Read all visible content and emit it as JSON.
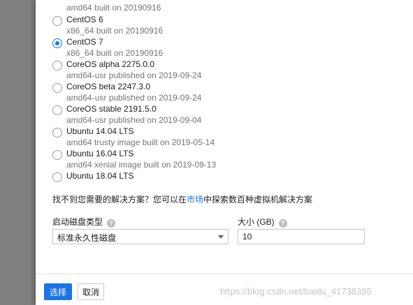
{
  "os_list": [
    {
      "name": "",
      "desc": "amd64 built on 20190916",
      "checked": false
    },
    {
      "name": "CentOS 6",
      "desc": "x86_64 built on 20190916",
      "checked": false
    },
    {
      "name": "CentOS 7",
      "desc": "x86_64 built on 20190916",
      "checked": true
    },
    {
      "name": "CoreOS alpha 2275.0.0",
      "desc": "amd64-usr published on 2019-09-24",
      "checked": false
    },
    {
      "name": "CoreOS beta 2247.3.0",
      "desc": "amd64-usr published on 2019-09-24",
      "checked": false
    },
    {
      "name": "CoreOS stable 2191.5.0",
      "desc": "amd64-usr published on 2019-09-04",
      "checked": false
    },
    {
      "name": "Ubuntu 14.04 LTS",
      "desc": "amd64 trusty image built on 2019-05-14",
      "checked": false
    },
    {
      "name": "Ubuntu 16.04 LTS",
      "desc": "amd64 xenial image built on 2019-09-13",
      "checked": false
    },
    {
      "name": "Ubuntu 18.04 LTS",
      "desc": "",
      "checked": false
    }
  ],
  "hint": {
    "prefix": "找不到您需要的解决方案？您可以在",
    "link": "市场",
    "suffix": "中探索数百种虚拟机解决方案"
  },
  "disk_type": {
    "label": "启动磁盘类型",
    "value": "标准永久性磁盘"
  },
  "disk_size": {
    "label": "大小 (GB)",
    "value": "10"
  },
  "buttons": {
    "select": "选择",
    "cancel": "取消"
  },
  "colors": {
    "accent": "#1a73e8",
    "backdrop": "#7f7f7f"
  },
  "watermark": "https://blog.csdn.net/baidu_41738395"
}
